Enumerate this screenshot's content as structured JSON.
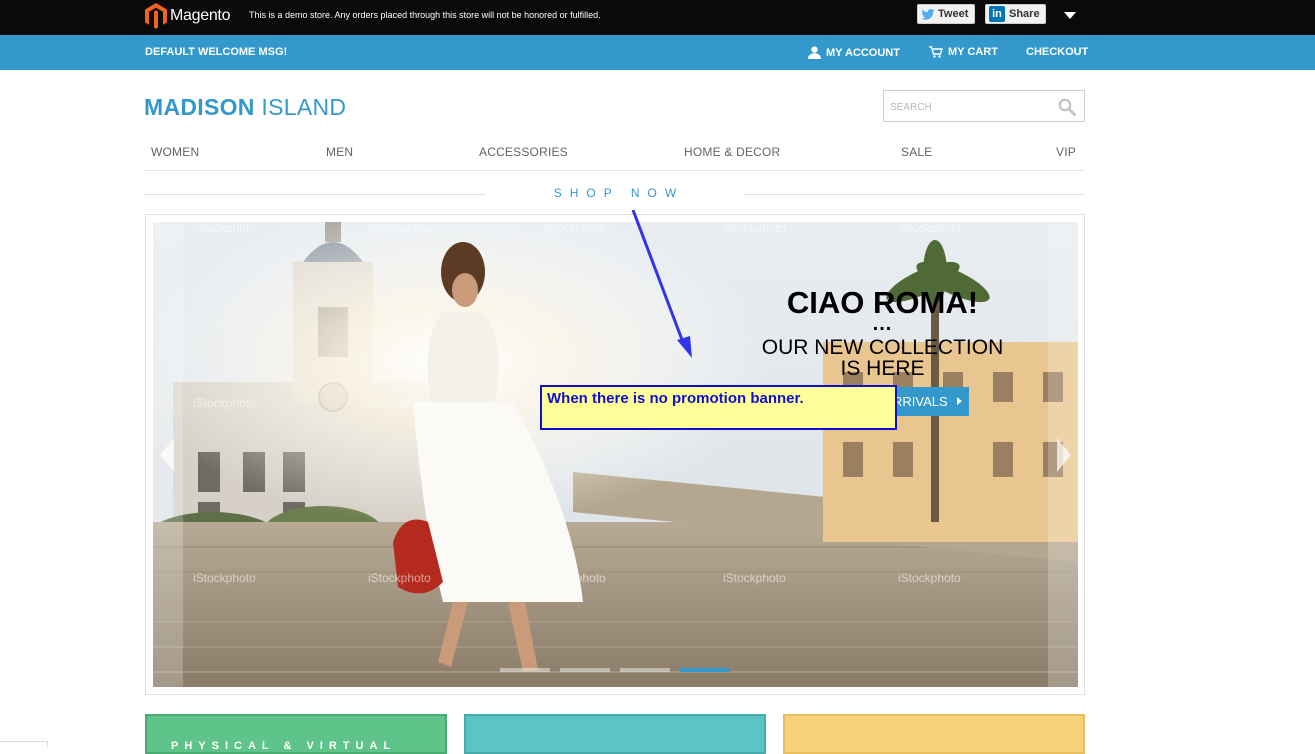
{
  "demo_bar": {
    "logo_text": "Magento",
    "notice": "This is a demo store. Any orders placed through this store will not be honored or fulfilled.",
    "tweet_label": "Tweet",
    "share_label": "Share",
    "linkedin_glyph": "in"
  },
  "header": {
    "welcome": "DEFAULT WELCOME MSG!",
    "my_account": "MY ACCOUNT",
    "my_cart": "MY CART",
    "checkout": "CHECKOUT"
  },
  "site_logo": {
    "bold": "MADISON",
    "light": " ISLAND"
  },
  "search": {
    "placeholder": "SEARCH"
  },
  "nav": {
    "items": [
      {
        "label": "WOMEN"
      },
      {
        "label": "MEN"
      },
      {
        "label": "ACCESSORIES"
      },
      {
        "label": "HOME & DECOR"
      },
      {
        "label": "SALE"
      },
      {
        "label": "VIP"
      }
    ]
  },
  "shop_now": "SHOP NOW",
  "slide": {
    "title": "CIAO ROMA!",
    "dots": "...",
    "subtitle_line1": "OUR NEW COLLECTION",
    "subtitle_line2": "IS HERE",
    "button_label": "RRIVALS",
    "watermark": "iStockphoto",
    "slide_count": 4,
    "active_slide": 4
  },
  "annotation": {
    "text": "When there is no promotion banner.",
    "color": "#1010cc",
    "background": "#ffff99"
  },
  "promo_tiles": [
    {
      "label": "PHYSICAL & VIRTUAL",
      "color": "#5fc48a"
    },
    {
      "label": "",
      "color": "#5bc5c5"
    },
    {
      "label": "",
      "color": "#f7d27a"
    }
  ],
  "colors": {
    "brand_blue": "#3399cc",
    "demo_bar": "#0a0a0a",
    "magento_orange": "#f26322"
  },
  "icons": {
    "logo": "magento-logo-icon",
    "tweet": "twitter-bird-icon",
    "share": "linkedin-icon",
    "toggle": "caret-down-icon",
    "account": "user-icon",
    "cart": "cart-icon",
    "search": "search-icon"
  }
}
